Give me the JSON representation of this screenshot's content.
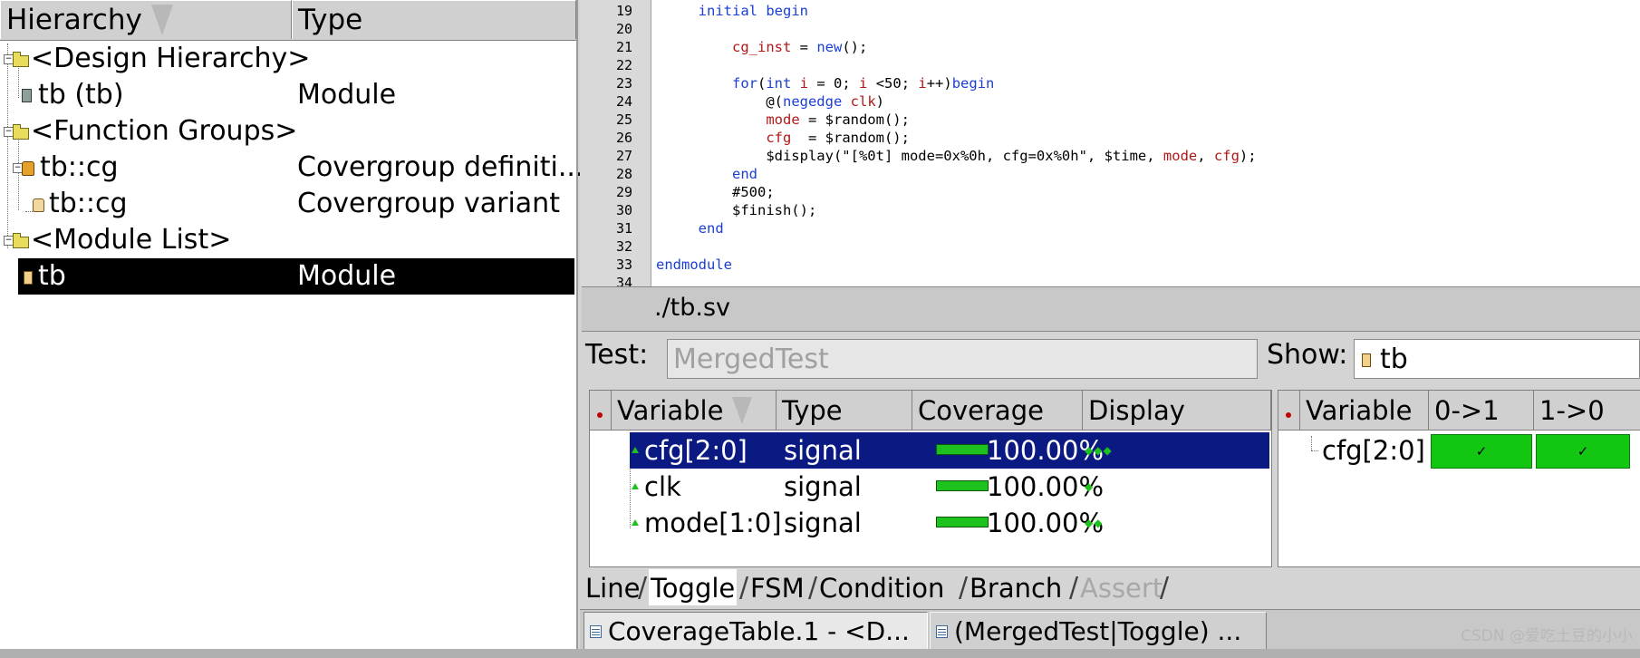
{
  "hierarchy": {
    "headers": {
      "name": "Hierarchy",
      "type": "Type"
    },
    "rows": [
      {
        "name": "<Design Hierarchy>",
        "type": ""
      },
      {
        "name": "tb (tb)",
        "type": "Module"
      },
      {
        "name": "<Function Groups>",
        "type": ""
      },
      {
        "name": "tb::cg",
        "type": "Covergroup definiti..."
      },
      {
        "name": "tb::cg",
        "type": "Covergroup variant"
      },
      {
        "name": "<Module List>",
        "type": ""
      },
      {
        "name": "tb",
        "type": "Module"
      }
    ],
    "selected_index": 6
  },
  "source": {
    "line_numbers": [
      "19",
      "20",
      "21",
      "22",
      "23",
      "24",
      "25",
      "26",
      "27",
      "28",
      "29",
      "30",
      "31",
      "32",
      "33",
      "34"
    ],
    "file_label": "./tb.sv"
  },
  "coverage": {
    "test_label": "Test:",
    "test_value": "MergedTest",
    "show_label": "Show:",
    "show_value": "tb",
    "var_table": {
      "headers": [
        "Variable",
        "Type",
        "Coverage",
        "Display"
      ],
      "rows": [
        {
          "variable": "cfg[2:0]",
          "type": "signal",
          "coverage": "100.00%",
          "coverage_fraction": 1.0
        },
        {
          "variable": "clk",
          "type": "signal",
          "coverage": "100.00%",
          "coverage_fraction": 1.0
        },
        {
          "variable": "mode[1:0]",
          "type": "signal",
          "coverage": "100.00%",
          "coverage_fraction": 1.0
        }
      ],
      "selected_index": 0
    },
    "toggle_table": {
      "headers": [
        "Variable",
        "0->1",
        "1->0"
      ],
      "rows": [
        {
          "variable": "cfg[2:0]",
          "rise": "✓",
          "fall": "✓"
        }
      ]
    },
    "tabs": [
      {
        "label": "Line",
        "state": "normal"
      },
      {
        "label": "Toggle",
        "state": "active"
      },
      {
        "label": "FSM",
        "state": "normal"
      },
      {
        "label": "Condition",
        "state": "normal"
      },
      {
        "label": "Branch",
        "state": "normal"
      },
      {
        "label": "Assert",
        "state": "disabled"
      }
    ]
  },
  "windows": [
    {
      "label": "CoverageTable.1 - <D..."
    },
    {
      "label": "(MergedTest|Toggle) ..."
    }
  ],
  "watermark": "CSDN @爱吃土豆的小小",
  "colors": {
    "selection_dark": "#0a1a82",
    "selection_black": "#000000",
    "coverage_green": "#12c612",
    "keyword_blue": "#1a3fd6",
    "identifier_red": "#b21818"
  }
}
